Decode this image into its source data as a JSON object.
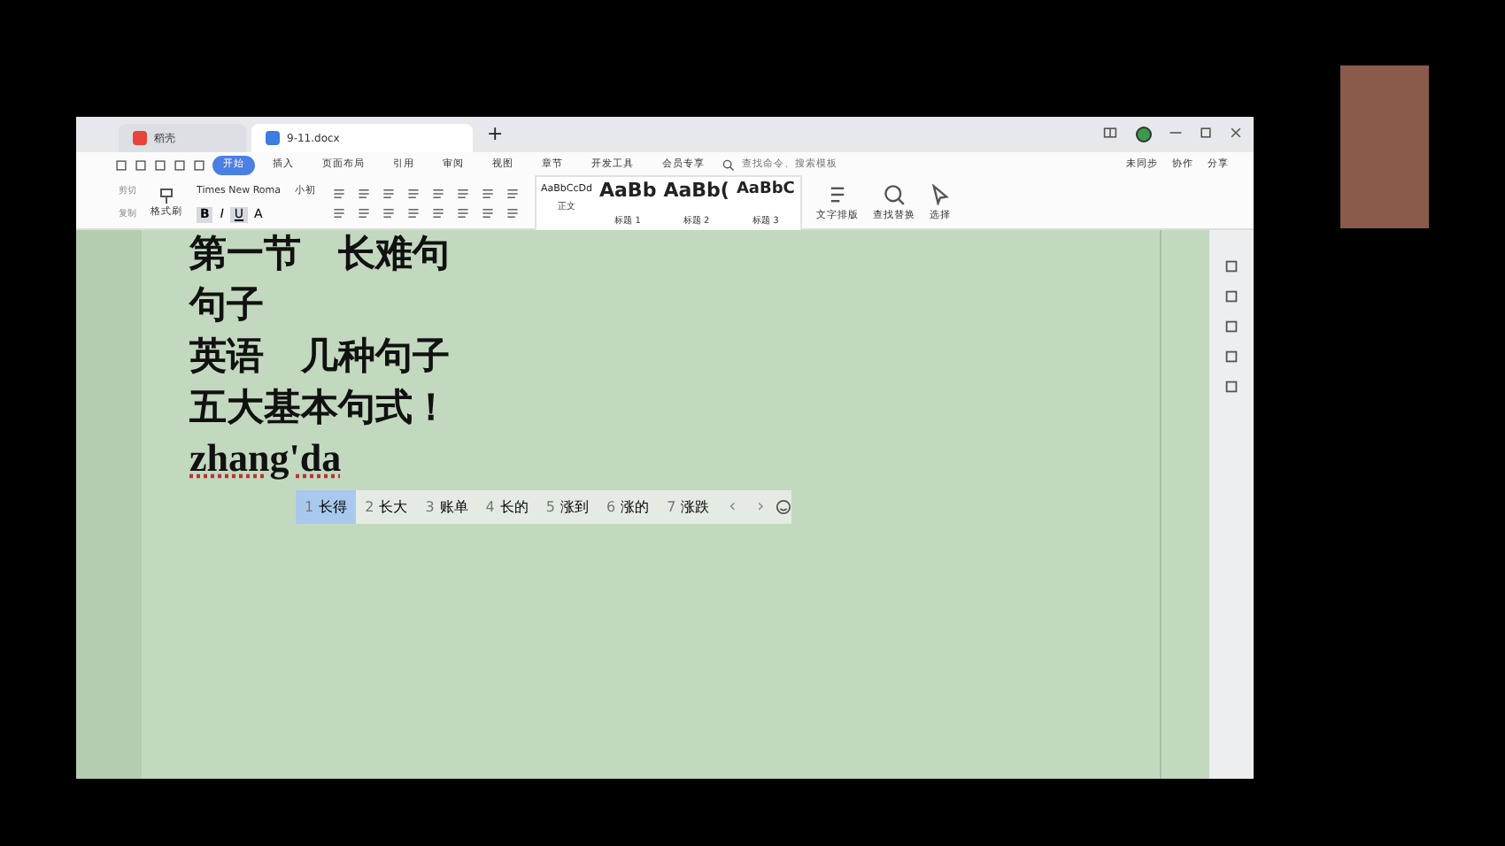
{
  "title_bar": {
    "tabs": [
      {
        "label": "稻壳",
        "kind": "home",
        "selected": false
      },
      {
        "label": "9-11.docx",
        "kind": "doc",
        "selected": true
      }
    ],
    "new_tab": "+"
  },
  "menu": [
    {
      "label": "开始",
      "selected": true
    },
    {
      "label": "插入",
      "selected": false
    },
    {
      "label": "页面布局",
      "selected": false
    },
    {
      "label": "引用",
      "selected": false
    },
    {
      "label": "审阅",
      "selected": false
    },
    {
      "label": "视图",
      "selected": false
    },
    {
      "label": "章节",
      "selected": false
    },
    {
      "label": "开发工具",
      "selected": false
    },
    {
      "label": "会员专享",
      "selected": false
    }
  ],
  "search": {
    "placeholder": "查找命令、搜索模板"
  },
  "account_actions": [
    "未同步",
    "协作",
    "分享"
  ],
  "clipboard": {
    "cut": "剪切",
    "copy": "复制",
    "format_painter": "格式刷"
  },
  "font": {
    "name": "Times New Roma",
    "size": "小初"
  },
  "format_buttons": [
    {
      "label": "B",
      "active": true
    },
    {
      "label": "I",
      "active": false
    },
    {
      "label": "U",
      "active": true
    },
    {
      "label": "A",
      "active": false
    }
  ],
  "styles": [
    {
      "sample": "AaBbCcDd",
      "label": "正文",
      "kind": "normal"
    },
    {
      "sample": "AaBb",
      "label": "标题 1",
      "kind": "h1"
    },
    {
      "sample": "AaBb(",
      "label": "标题 2",
      "kind": "h2"
    },
    {
      "sample": "AaBbC",
      "label": "标题 3",
      "kind": "h3"
    }
  ],
  "tools": [
    {
      "label": "文字排版",
      "kind": "layout"
    },
    {
      "label": "查找替换",
      "kind": "find"
    },
    {
      "label": "选择",
      "kind": "select"
    }
  ],
  "document": {
    "lines": [
      "第一节　长难句",
      "句子",
      "英语　几种句子",
      "五大基本句式！"
    ],
    "composing": "zhang'da"
  },
  "ime": {
    "candidates": [
      {
        "index": "1",
        "text": "长得",
        "selected": true
      },
      {
        "index": "2",
        "text": "长大",
        "selected": false
      },
      {
        "index": "3",
        "text": "账单",
        "selected": false
      },
      {
        "index": "4",
        "text": "长的",
        "selected": false
      },
      {
        "index": "5",
        "text": "涨到",
        "selected": false
      },
      {
        "index": "6",
        "text": "涨的",
        "selected": false
      },
      {
        "index": "7",
        "text": "涨跌",
        "selected": false
      }
    ],
    "prev": "‹",
    "next": "›"
  }
}
